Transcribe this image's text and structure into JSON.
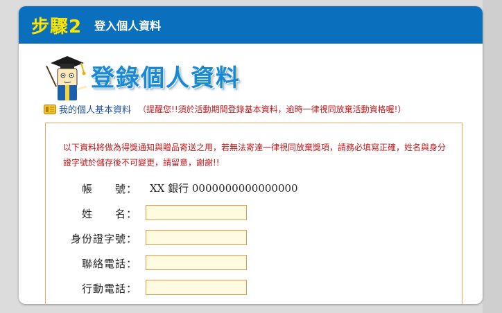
{
  "header": {
    "step": "步驟2",
    "title": "登入個人資料"
  },
  "hero": {
    "title": "登錄個人資料"
  },
  "section": {
    "title": "我的個人基本資料",
    "note": "（提醒您!!須於活動期間登錄基本資料，逾時一律視同放棄活動資格喔!）"
  },
  "form": {
    "notice": "以下資料將做為得獎通知與贈品寄送之用，若無法寄達一律視同放棄獎項，請務必填寫正確，姓名與身分證字號於儲存後不可變更，請留意，謝謝!!",
    "account_label": "帳　　號：",
    "account_value": "XX 銀行 0000000000000000",
    "fields": [
      {
        "label": "姓　　名：",
        "value": "",
        "placeholder": ""
      },
      {
        "label": "身份證字號：",
        "value": "",
        "placeholder": ""
      },
      {
        "label": "聯絡電話：",
        "value": "",
        "placeholder": ""
      },
      {
        "label": "行動電話：",
        "value": "",
        "placeholder": ""
      }
    ]
  },
  "colors": {
    "header_bg": "#0a6fbd",
    "step_text": "#ffe400",
    "hero_title": "#1a89d4",
    "notice_text": "#c0181b",
    "form_border": "#f0a860",
    "field_bg": "#fffbe0"
  },
  "icons": {
    "mascot": "graduate-mascot-icon",
    "section": "id-card-icon"
  }
}
